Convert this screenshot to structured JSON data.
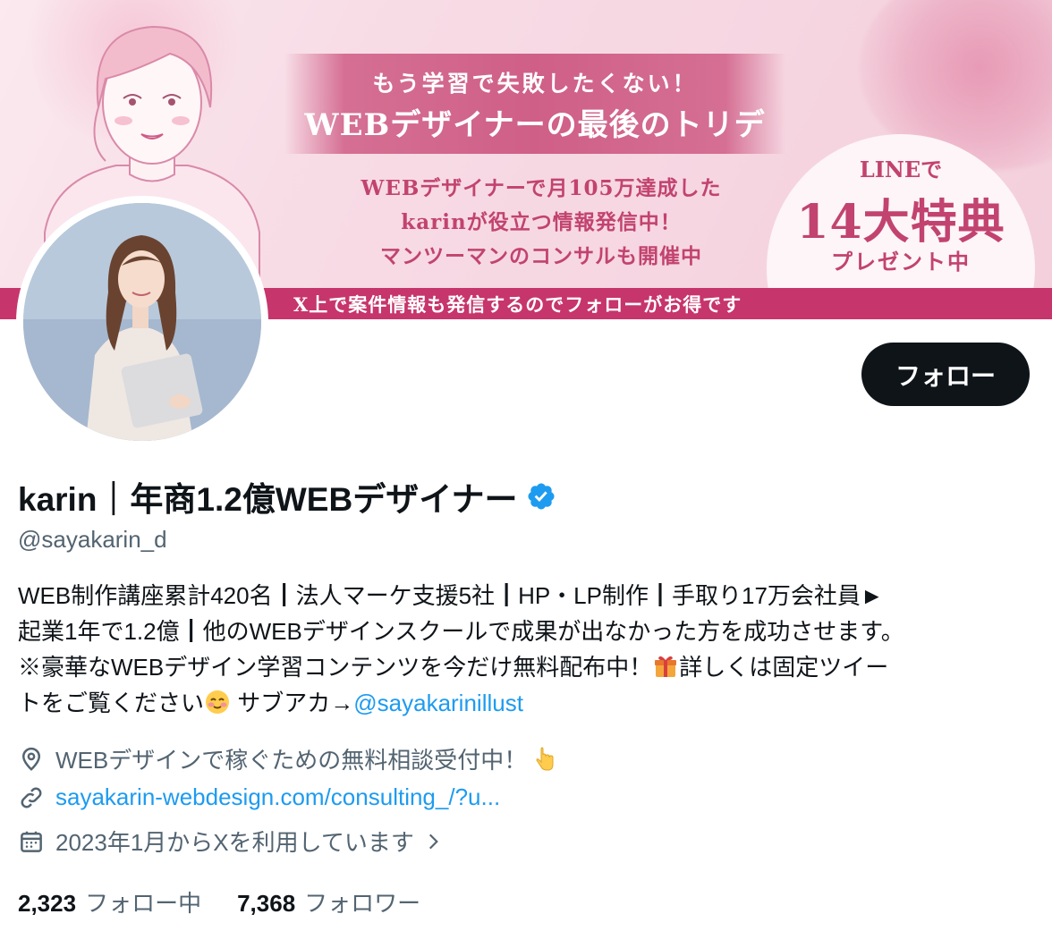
{
  "banner": {
    "ribbon_sub": "もう学習で失敗したくない！",
    "ribbon_main": "WEBデザイナーの最後のトリデ",
    "promo_lines": [
      "WEBデザイナーで月105万達成した",
      "karinが役立つ情報発信中！",
      "マンツーマンのコンサルも開催中"
    ],
    "line_top": "LINEで",
    "line_big": "14大特典",
    "line_bottom": "プレゼント中",
    "strip": "X上で案件情報も発信するのでフォローがお得です",
    "colors": {
      "primary": "#c6356b",
      "accent_text": "#c2436f"
    }
  },
  "profile": {
    "display_name": "karin｜年商1.2億WEBデザイナー",
    "handle": "@sayakarin_d",
    "verified_icon": "verified-badge-icon",
    "follow_label": "フォロー",
    "bio": {
      "line1": "WEB制作講座累計420名┃法人マーケ支援5社┃HP・LP制作┃手取り17万会社員►",
      "line2": "起業1年で1.2億┃他のWEBデザインスクールで成果が出なかった方を成功させます。",
      "line3a": "※豪華なWEBデザイン学習コンテンツを今だけ無料配布中！",
      "line3b": "詳しくは固定ツイー",
      "line4a": "トをご覧ください",
      "line4b": " サブアカ→",
      "mention": "@sayakarinillust"
    },
    "location": "WEBデザインで稼ぐための無料相談受付中！",
    "url": "sayakarin-webdesign.com/consulting_/?u...",
    "joined": "2023年1月からXを利用しています",
    "following_count": "2,323",
    "following_label": "フォロー中",
    "followers_count": "7,368",
    "followers_label": "フォロワー"
  },
  "colors": {
    "link": "#1d9bf0",
    "text": "#0f1419",
    "secondary": "#536471",
    "button_bg": "#0f1419"
  }
}
